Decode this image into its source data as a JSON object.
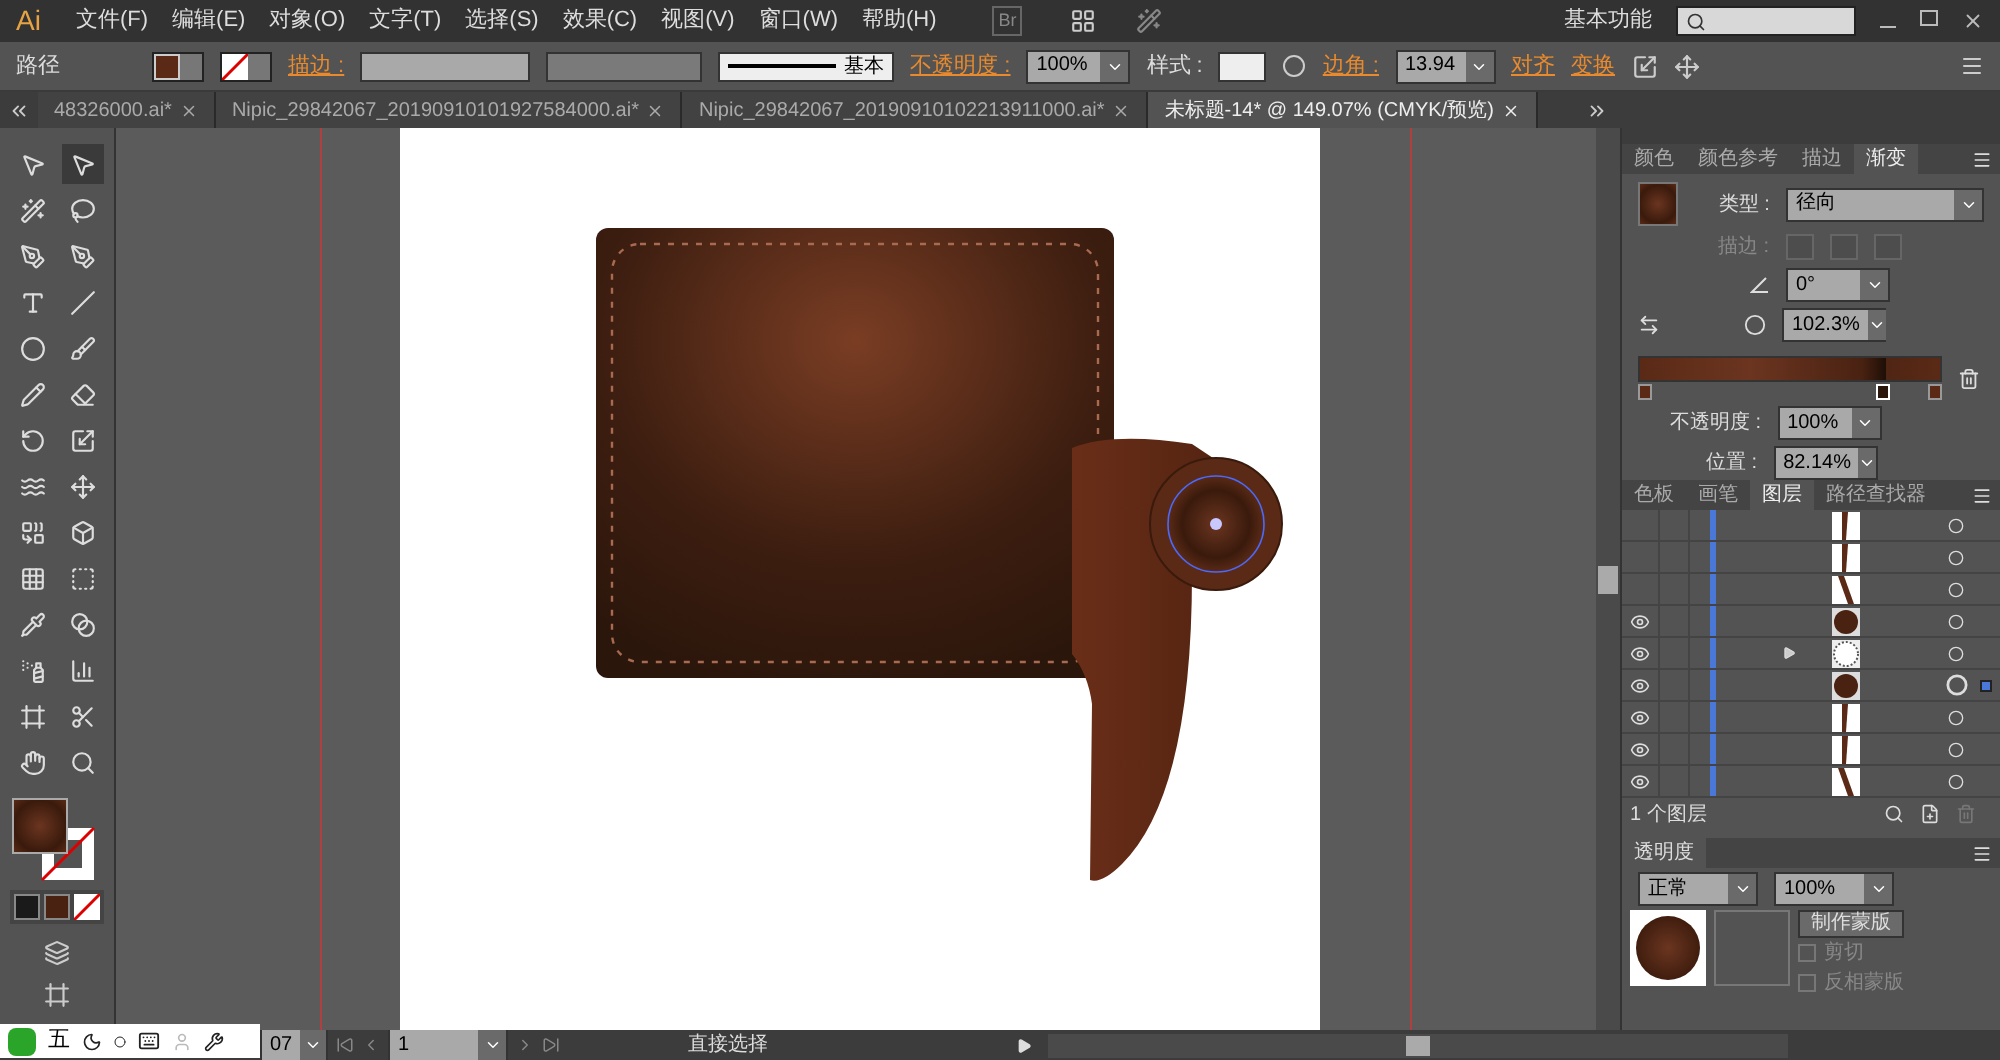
{
  "menu_bar": {
    "logo": "Ai",
    "items": [
      "文件(F)",
      "编辑(E)",
      "对象(O)",
      "文字(T)",
      "选择(S)",
      "效果(C)",
      "视图(V)",
      "窗口(W)",
      "帮助(H)"
    ],
    "bridge": "Br",
    "workspace": "基本功能"
  },
  "control_bar": {
    "selection": "路径",
    "stroke_label": "描边 :",
    "stroke_profile": "基本",
    "opacity_label": "不透明度 :",
    "opacity": "100%",
    "style_label": "样式 :",
    "corner_label": "边角 :",
    "corner": "13.94",
    "align_link": "对齐",
    "transform_link": "变换"
  },
  "document_tabs": [
    {
      "label": "48326000.ai*",
      "selected": false
    },
    {
      "label": "Nipic_29842067_20190910101927584000.ai*",
      "selected": false
    },
    {
      "label": "Nipic_29842067_20190910102213911000.ai*",
      "selected": false
    },
    {
      "label": "未标题-14* @ 149.07% (CMYK/预览)",
      "selected": true
    }
  ],
  "tools": [
    {
      "kind": "select",
      "selected": false
    },
    {
      "kind": "direct",
      "selected": true
    },
    {
      "kind": "wand",
      "selected": false
    },
    {
      "kind": "lasso",
      "selected": false
    },
    {
      "kind": "pen",
      "selected": false
    },
    {
      "kind": "curvature",
      "selected": false
    },
    {
      "kind": "type",
      "selected": false
    },
    {
      "kind": "line",
      "selected": false
    },
    {
      "kind": "ellipse",
      "selected": false
    },
    {
      "kind": "brush",
      "selected": false
    },
    {
      "kind": "pencil",
      "selected": false
    },
    {
      "kind": "eraser",
      "selected": false
    },
    {
      "kind": "rotate",
      "selected": false
    },
    {
      "kind": "scale",
      "selected": false
    },
    {
      "kind": "warp",
      "selected": false
    },
    {
      "kind": "freetransform",
      "selected": false
    },
    {
      "kind": "shapebuilder",
      "selected": false
    },
    {
      "kind": "perspective",
      "selected": false
    },
    {
      "kind": "mesh",
      "selected": false
    },
    {
      "kind": "gradient",
      "selected": false
    },
    {
      "kind": "eyedropper",
      "selected": false
    },
    {
      "kind": "blend",
      "selected": false
    },
    {
      "kind": "symbol",
      "selected": false
    },
    {
      "kind": "graph",
      "selected": false
    },
    {
      "kind": "artboard",
      "selected": false
    },
    {
      "kind": "slice",
      "selected": false
    },
    {
      "kind": "hand",
      "selected": false
    },
    {
      "kind": "zoom",
      "selected": false
    }
  ],
  "gradient_panel": {
    "tabs": [
      {
        "label": "颜色",
        "selected": false
      },
      {
        "label": "颜色参考",
        "selected": false
      },
      {
        "label": "描边",
        "selected": false
      },
      {
        "label": "渐变",
        "selected": true
      }
    ],
    "stops": [
      {
        "selected": false
      },
      {
        "selected": true
      },
      {
        "selected": false
      }
    ],
    "level": 0.8214,
    "type_label": "类型 :",
    "type": "径向",
    "stroke_label": "描边 :",
    "angle": "0°",
    "aspect": "102.3%",
    "opacity_label": "不透明度 :",
    "opacity": "100%",
    "location_label": "位置 :",
    "location": "82.14%"
  },
  "layers_panel": {
    "tabs": [
      {
        "label": "色板",
        "selected": false
      },
      {
        "label": "画笔",
        "selected": false
      },
      {
        "label": "图层",
        "selected": true
      },
      {
        "label": "路径查找器",
        "selected": false
      }
    ],
    "rows": [
      {
        "visible": false,
        "kind": "strip",
        "expandable": false,
        "selected": false
      },
      {
        "visible": false,
        "kind": "strip",
        "expandable": false,
        "selected": false
      },
      {
        "visible": false,
        "kind": "wedge",
        "expandable": false,
        "selected": false
      },
      {
        "visible": true,
        "kind": "circle",
        "expandable": false,
        "selected": false
      },
      {
        "visible": true,
        "kind": "group",
        "expandable": true,
        "selected": false
      },
      {
        "visible": true,
        "kind": "circle",
        "expandable": false,
        "selected": true
      },
      {
        "visible": true,
        "kind": "strip",
        "expandable": false,
        "selected": false
      },
      {
        "visible": true,
        "kind": "strip",
        "expandable": false,
        "selected": false
      },
      {
        "visible": true,
        "kind": "wedge",
        "expandable": false,
        "selected": false
      }
    ],
    "footer": "1 个图层"
  },
  "transparency_panel": {
    "tab": "透明度",
    "blend_mode": "正常",
    "opacity": "100%",
    "make_mask": "制作蒙版",
    "clip": {
      "label": "剪切",
      "checked": false
    },
    "invert": {
      "label": "反相蒙版",
      "checked": false
    }
  },
  "status_bar": {
    "zoom": "07",
    "page": "1",
    "tool": "直接选择"
  },
  "ime_bar": {
    "mode": "五"
  }
}
